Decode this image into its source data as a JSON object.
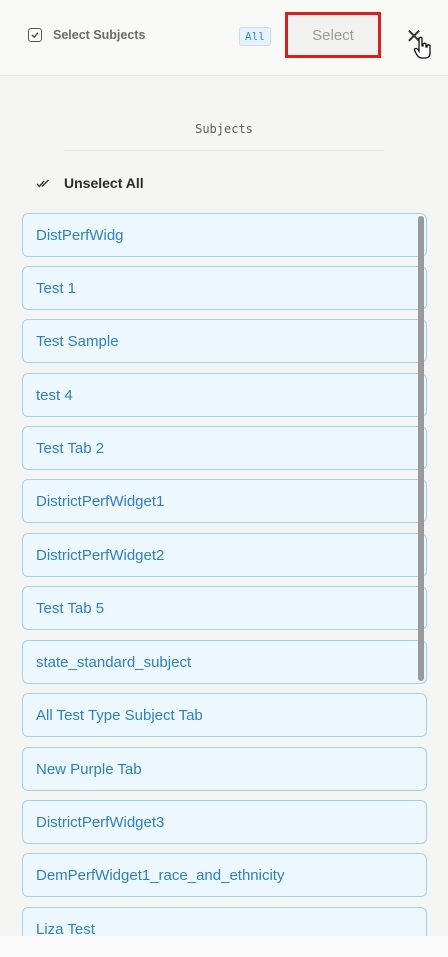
{
  "header": {
    "title": "Select Subjects",
    "badge": "All",
    "select_label": "Select",
    "close_label": "✕"
  },
  "section": {
    "title": "Subjects",
    "unselect_label": "Unselect All"
  },
  "subjects": [
    "DistPerfWidg",
    "Test 1",
    "Test Sample",
    "test 4",
    "Test Tab 2",
    "DistrictPerfWidget1",
    "DistrictPerfWidget2",
    "Test Tab 5",
    "state_standard_subject",
    "All Test Type Subject Tab",
    "New Purple Tab",
    "DistrictPerfWidget3",
    "DemPerfWidget1_race_and_ethnicity",
    "Liza Test"
  ],
  "colors": {
    "highlight_border": "#e01d1d",
    "item_background": "#ecf7fe",
    "item_border": "#9fd3f4",
    "item_text": "#2f7fc4"
  }
}
